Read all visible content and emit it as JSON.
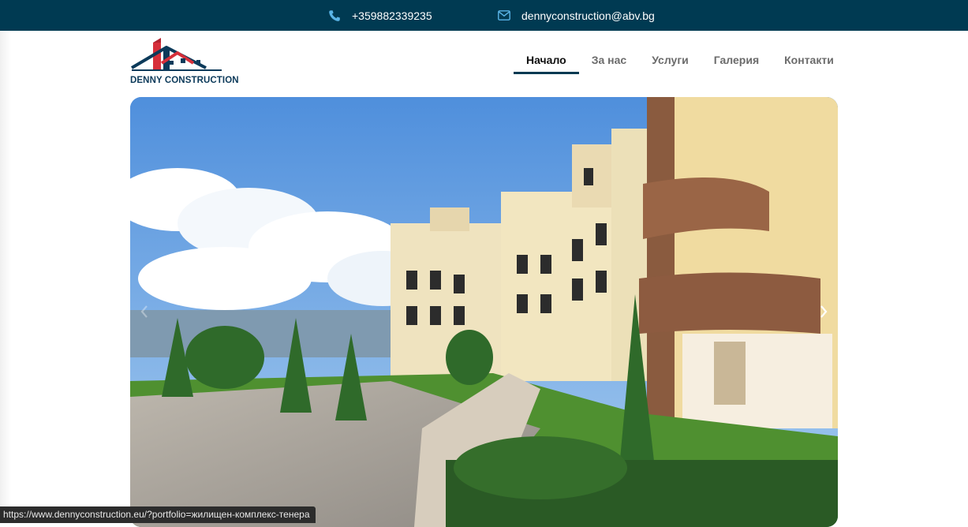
{
  "topbar": {
    "phone": "+359882339235",
    "email": "dennyconstruction@abv.bg",
    "phone_icon": "phone-icon",
    "email_icon": "envelope-icon",
    "background": "#003a52"
  },
  "logo": {
    "text": "DENNY CONSTRUCTION",
    "colors": {
      "red": "#d62f3a",
      "navy": "#0c3a5a"
    }
  },
  "nav": {
    "items": [
      {
        "label": "Начало",
        "active": true
      },
      {
        "label": "За нас",
        "active": false
      },
      {
        "label": "Услуги",
        "active": false
      },
      {
        "label": "Галерия",
        "active": false
      },
      {
        "label": "Контакти",
        "active": false
      }
    ],
    "active_underline_color": "#003a52"
  },
  "slider": {
    "image_description_icon": "residential-complex-photo",
    "prev_icon": "chevron-left-icon",
    "next_icon": "chevron-right-icon"
  },
  "statusbar": {
    "url": "https://www.dennyconstruction.eu/?portfolio=жилищен-комплекс-тенера"
  }
}
